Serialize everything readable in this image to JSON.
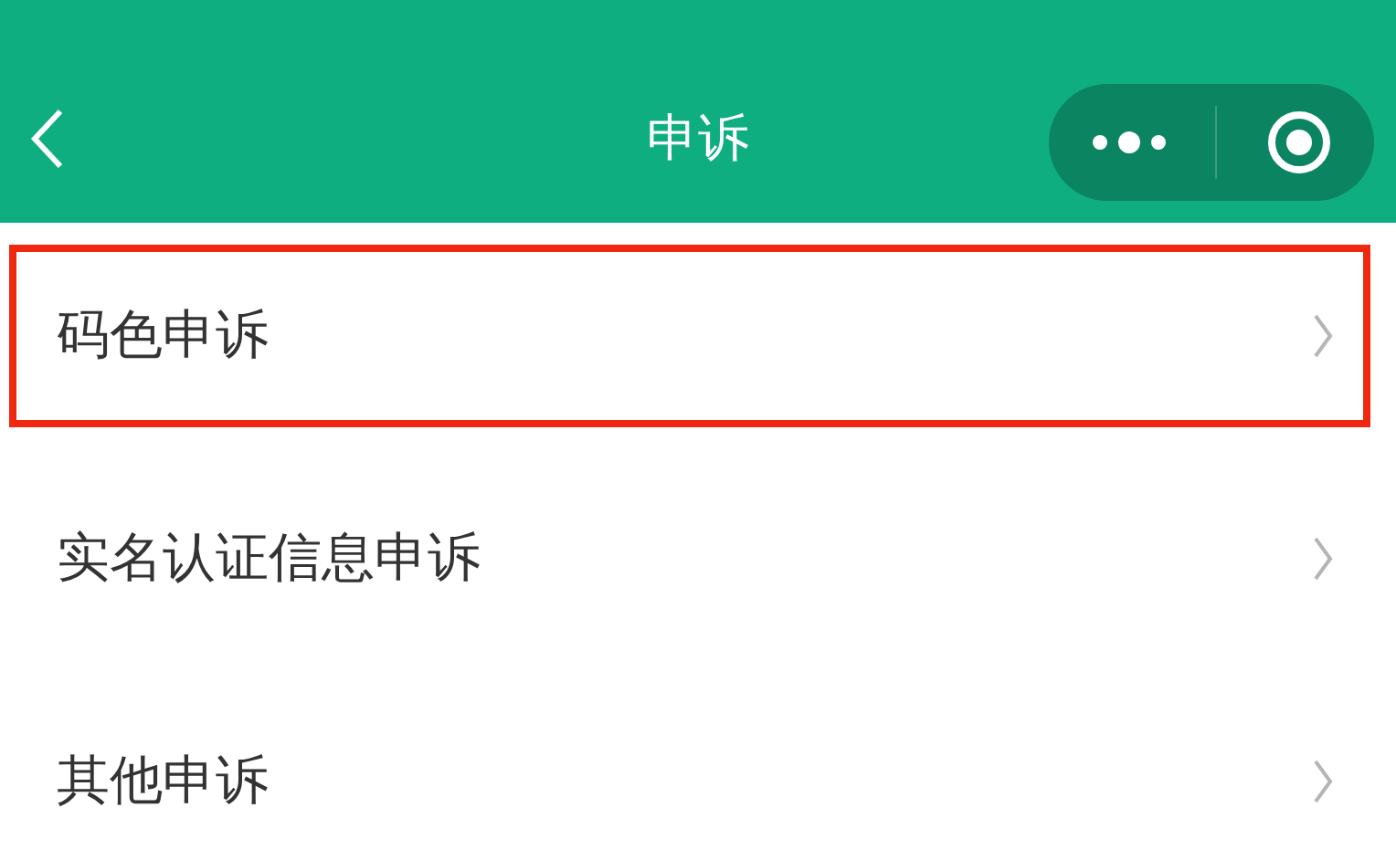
{
  "nav_bar": {
    "title": "申诉"
  },
  "items": [
    {
      "label": "码色申诉",
      "highlighted": true
    },
    {
      "label": "实名认证信息申诉",
      "highlighted": false
    },
    {
      "label": "其他申诉",
      "highlighted": false
    }
  ]
}
